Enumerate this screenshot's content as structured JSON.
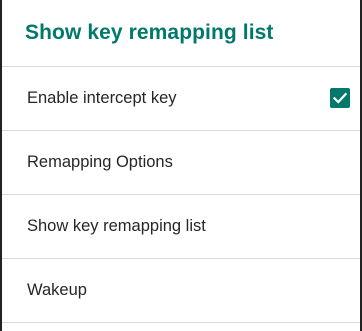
{
  "dialog": {
    "title": "Show key remapping list"
  },
  "items": [
    {
      "label": "Enable intercept key",
      "checked": true
    },
    {
      "label": "Remapping Options"
    },
    {
      "label": "Show key remapping list"
    },
    {
      "label": "Wakeup"
    }
  ],
  "colors": {
    "accent": "#00796b",
    "text": "#262626",
    "divider": "#d8d8d8"
  },
  "icons": {
    "checkbox": "checkmark-icon"
  }
}
